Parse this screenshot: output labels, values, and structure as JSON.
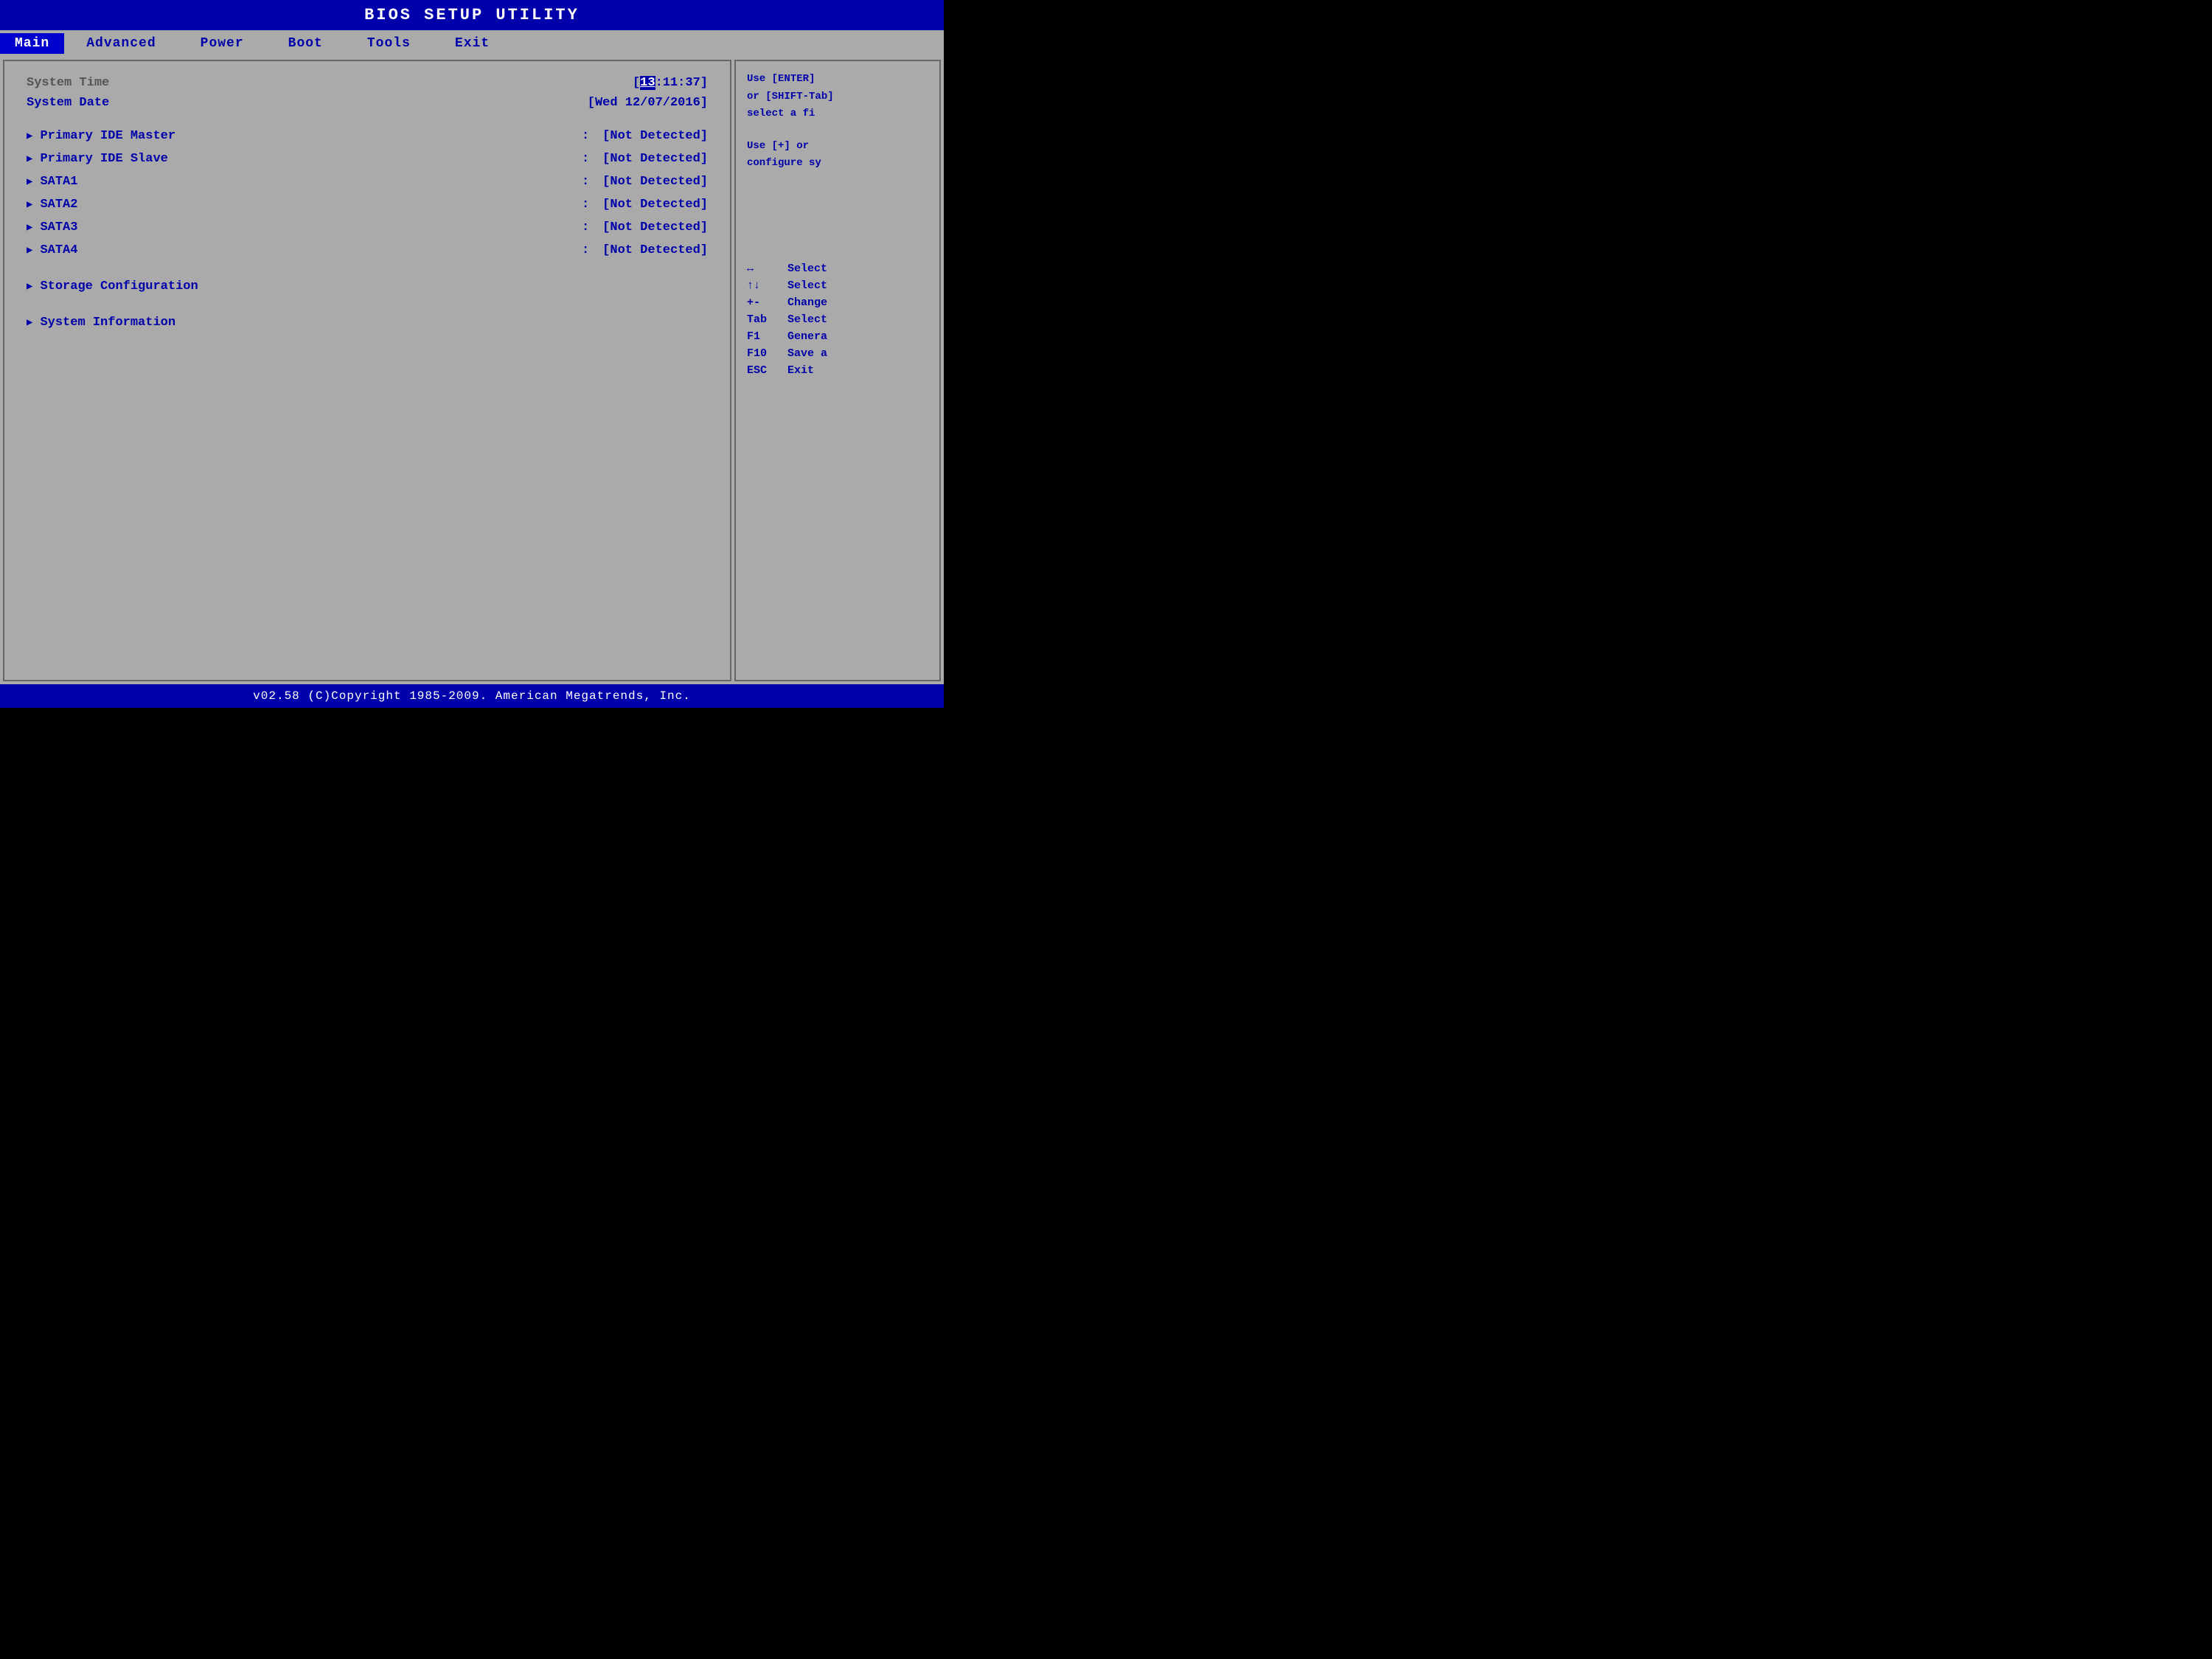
{
  "title": "BIOS  SETUP  UTILITY",
  "menu": {
    "items": [
      {
        "label": "Main",
        "active": true
      },
      {
        "label": "Advanced",
        "active": false
      },
      {
        "label": "Power",
        "active": false
      },
      {
        "label": "Boot",
        "active": false
      },
      {
        "label": "Tools",
        "active": false
      },
      {
        "label": "Exit",
        "active": false
      }
    ]
  },
  "main": {
    "system_time_label": "System Time",
    "system_time_value": "[13:11:37]",
    "system_date_label": "System Date",
    "system_date_value": "[Wed 12/07/2016]",
    "entries": [
      {
        "label": "Primary IDE Master",
        "value": "[Not Detected]"
      },
      {
        "label": "Primary IDE Slave",
        "value": "[Not Detected]"
      },
      {
        "label": "SATA1",
        "value": "[Not Detected]"
      },
      {
        "label": "SATA2",
        "value": "[Not Detected]"
      },
      {
        "label": "SATA3",
        "value": "[Not Detected]"
      },
      {
        "label": "SATA4",
        "value": "[Not Detected]"
      }
    ],
    "submenu_entries": [
      {
        "label": "Storage Configuration"
      },
      {
        "label": "System Information"
      }
    ]
  },
  "sidebar": {
    "help_line1": "Use [ENTER]",
    "help_line2": "or [SHIFT-Tab]",
    "help_line3": "select a fi",
    "help_line4": "Use [+] or",
    "help_line5": "configure sy",
    "keys": [
      {
        "symbol": "↔",
        "desc": "Select"
      },
      {
        "symbol": "↑↓",
        "desc": "Select"
      },
      {
        "symbol": "+-",
        "desc": "Change"
      },
      {
        "symbol": "Tab",
        "desc": "Select"
      },
      {
        "symbol": "F1",
        "desc": "Genera"
      },
      {
        "symbol": "F10",
        "desc": "Save a"
      },
      {
        "symbol": "ESC",
        "desc": "Exit"
      }
    ]
  },
  "footer": "v02.58  (C)Copyright  1985-2009.  American  Megatrends,  Inc."
}
